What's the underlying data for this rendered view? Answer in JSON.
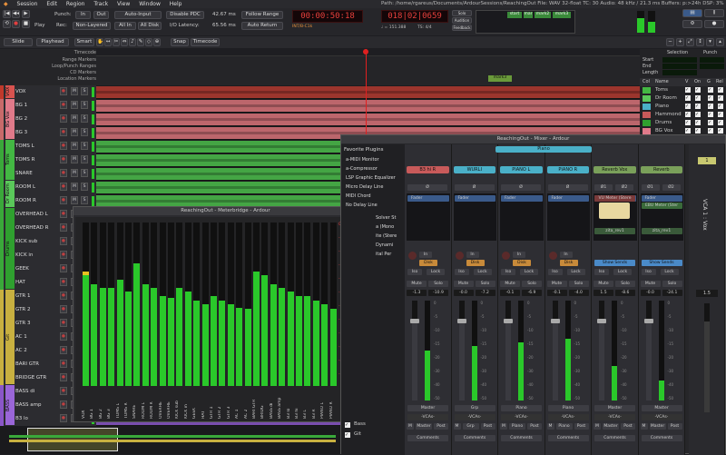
{
  "menu": [
    "Session",
    "Edit",
    "Region",
    "Track",
    "View",
    "Window",
    "Help"
  ],
  "path_info": "Path: /home/rgareus/Documents/ArdourSessions/ReachingOut   File: WAV 32-float   TC: 30   Audio: 48 kHz / 21.3 ms   Buffers: p:>24h   DSP: 3%",
  "transport": {
    "punch_label": "Punch:",
    "in_label": "In",
    "out_label": "Out",
    "play_label": "Play",
    "rec_label": "Rec:",
    "non_layered": "Non-Layered",
    "auto_input": "Auto-Input",
    "all_in": "All In",
    "all_disk": "All Disk",
    "disable_pdc": "Disable PDC",
    "io_latency_label": "I/O Latency:",
    "latency_1": "42.67 ms",
    "latency_2": "65.56 ms",
    "follow_range": "Follow Range",
    "auto_return": "Auto Return",
    "int_label": "INT/B-C1k",
    "primary_clock": "00:00:50:18",
    "secondary_clock": "018|02|0659",
    "tempo": "♩ = 151.388",
    "ts": "TS: 4/4",
    "solo": "Solo",
    "audition": "Audition",
    "feedback": "Feedback",
    "markers": [
      "start",
      "mar",
      "mark2",
      "mark3"
    ]
  },
  "toolbar": {
    "mode": "Slide",
    "playhead": "Playhead",
    "smart": "Smart",
    "snap": "Snap",
    "timecode": "Timecode"
  },
  "rulers": [
    "Timecode",
    "Range Markers",
    "Loop/Punch Ranges",
    "CD Markers",
    "Location Markers"
  ],
  "marker3": "mark3",
  "tracks": [
    {
      "name": "VOX",
      "color": "#c0392b",
      "region": "#b33a30",
      "group": "VOX",
      "gcolor": "#d9534f"
    },
    {
      "name": "BG 1",
      "color": "#c86a6a",
      "region": "#d9737a",
      "group": "BG Vox",
      "gcolor": "#e07a8a"
    },
    {
      "name": "BG 2",
      "color": "#c86a6a",
      "region": "#d9737a",
      "group": "",
      "gcolor": ""
    },
    {
      "name": "BG 3",
      "color": "#c86a6a",
      "region": "#d9737a",
      "group": "",
      "gcolor": ""
    },
    {
      "name": "TOMS L",
      "color": "#3aa83a",
      "region": "#4bbd4b",
      "group": "Toms",
      "gcolor": "#43b843"
    },
    {
      "name": "TOMS R",
      "color": "#3aa83a",
      "region": "#4bbd4b",
      "group": "",
      "gcolor": ""
    },
    {
      "name": "SNARE",
      "color": "#3aa83a",
      "region": "#4bbd4b",
      "group": "",
      "gcolor": ""
    },
    {
      "name": "ROOM L",
      "color": "#3aa83a",
      "region": "#4bbd4b",
      "group": "Dr Room",
      "gcolor": "#5ac85a"
    },
    {
      "name": "ROOM R",
      "color": "#3aa83a",
      "region": "#4bbd4b",
      "group": "",
      "gcolor": ""
    },
    {
      "name": "OVERHEAD L",
      "color": "#3aa83a",
      "region": "#4bbd4b",
      "group": "Drums",
      "gcolor": "#2fa02f"
    },
    {
      "name": "OVERHEAD R",
      "color": "#3aa83a",
      "region": "#4bbd4b",
      "group": "",
      "gcolor": ""
    },
    {
      "name": "KICK sub",
      "color": "#3aa83a",
      "region": "#4bbd4b",
      "group": "",
      "gcolor": ""
    },
    {
      "name": "KICK in",
      "color": "#3aa83a",
      "region": "#4bbd4b",
      "group": "",
      "gcolor": ""
    },
    {
      "name": "GEEK",
      "color": "#3aa83a",
      "region": "#4bbd4b",
      "group": "",
      "gcolor": ""
    },
    {
      "name": "HAT",
      "color": "#3aa83a",
      "region": "#4bbd4b",
      "group": "",
      "gcolor": ""
    },
    {
      "name": "GTR 1",
      "color": "#c8b040",
      "region": "#c8b040",
      "group": "Git",
      "gcolor": "#c8b040"
    },
    {
      "name": "GTR 2",
      "color": "#c8b040",
      "region": "#c8b040",
      "group": "",
      "gcolor": ""
    },
    {
      "name": "GTR 3",
      "color": "#c8b040",
      "region": "#c8b040",
      "group": "",
      "gcolor": ""
    },
    {
      "name": "AC 1",
      "color": "#c8b040",
      "region": "#c8b040",
      "group": "",
      "gcolor": ""
    },
    {
      "name": "AC 2",
      "color": "#c8b040",
      "region": "#c8b040",
      "group": "",
      "gcolor": ""
    },
    {
      "name": "BARI GTR",
      "color": "#c8b040",
      "region": "#c8b040",
      "group": "",
      "gcolor": ""
    },
    {
      "name": "BRIDGE GTR",
      "color": "#c8b040",
      "region": "#c8b040",
      "group": "",
      "gcolor": ""
    },
    {
      "name": "BASS di",
      "color": "#8a56c8",
      "region": "#8a56c8",
      "group": "BASS",
      "gcolor": "#9a66d8"
    },
    {
      "name": "BASS amp",
      "color": "#8a56c8",
      "region": "#8a56c8",
      "group": "",
      "gcolor": ""
    },
    {
      "name": "B3 lo",
      "color": "#8a56c8",
      "region": "#8a56c8",
      "group": "",
      "gcolor": ""
    }
  ],
  "track_buttons": {
    "rec": "●",
    "mute": "M",
    "solo": "S"
  },
  "right_panel": {
    "selection": "Selection",
    "punch": "Punch",
    "start": "Start",
    "end": "End",
    "length": "Length",
    "col_header": [
      "Col",
      "Name",
      "V",
      "On",
      "G",
      "Rel"
    ],
    "groups": [
      {
        "name": "Toms",
        "color": "#43b843"
      },
      {
        "name": "Dr Room",
        "color": "#5ac85a"
      },
      {
        "name": "Piano",
        "color": "#4ab0c8"
      },
      {
        "name": "Hammond",
        "color": "#c85a5a"
      },
      {
        "name": "Drums",
        "color": "#2fa02f"
      },
      {
        "name": "BG Vox",
        "color": "#e07a8a"
      }
    ]
  },
  "meterbridge": {
    "title": "ReachingOut - Meterbridge - Ardour",
    "labels": [
      "VOX",
      "BG 1",
      "BG 2",
      "BG 3",
      "TOMS L",
      "TOMS R",
      "SNARE",
      "ROOM L",
      "ROOM R",
      "OVERHE",
      "OVERHE",
      "KICK sub",
      "KICK in",
      "GEEK",
      "HAT",
      "GTR 1",
      "GTR 2",
      "GTR 3",
      "AC 1",
      "AC 2",
      "BARI GTR",
      "BRIDG",
      "BASS di",
      "BASS amp",
      "B3 lo",
      "B3 hi",
      "B3 L",
      "B3 R",
      "PIANO L",
      "PIANO R"
    ],
    "levels": [
      0.7,
      0.62,
      0.6,
      0.6,
      0.65,
      0.58,
      0.75,
      0.62,
      0.6,
      0.55,
      0.54,
      0.6,
      0.58,
      0.52,
      0.5,
      0.55,
      0.52,
      0.5,
      0.48,
      0.47,
      0.7,
      0.68,
      0.62,
      0.6,
      0.58,
      0.55,
      0.55,
      0.52,
      0.5,
      0.47
    ],
    "master_label": "Master",
    "scale": [
      "0",
      "-3",
      "-5",
      "-10",
      "-15",
      "-20",
      "-25",
      "-30",
      "-35",
      "-40",
      "-45",
      "-50"
    ]
  },
  "mixer": {
    "title": "ReachingOut - Mixer - Ardour",
    "favorite_plugins": "Favorite Plugins",
    "plugins": [
      "a-MIDI Monitor",
      "a-Compressor",
      "LSP Graphic Equalizer",
      "Micro Delay Line",
      "MIDI Chord",
      "No Delay Line"
    ],
    "tail_plugins": [
      "Solver St",
      "a (Mono",
      "ite (Stere",
      "Dynami",
      "ital Per"
    ],
    "strips": [
      {
        "name": "B3 hi R",
        "color": "#c85a5a",
        "gain": "-1.3",
        "peak": "-10.9",
        "out": "Master",
        "level": 0.5
      },
      {
        "name": "WURLI",
        "color": "#4ab0c8",
        "gain": "-0.0",
        "peak": "-7.2",
        "out": "Grp",
        "level": 0.55
      },
      {
        "name": "PIANO L",
        "color": "#4ab0c8",
        "gain": "-0.1",
        "peak": "-6.9",
        "out": "Piano",
        "level": 0.58
      },
      {
        "name": "PIANO R",
        "color": "#4ab0c8",
        "gain": "-0.1",
        "peak": "-4.0",
        "out": "Piano",
        "level": 0.62
      },
      {
        "name": "Reverb Vox",
        "color": "#7aa05a",
        "gain": "1.5",
        "peak": "-8.6",
        "out": "Master",
        "level": 0.35
      },
      {
        "name": "Reverb",
        "color": "#7aa05a",
        "gain": "-0.0",
        "peak": "-24.1",
        "out": "Master",
        "level": 0.2
      }
    ],
    "piano_group": "Piano",
    "fader": "Fader",
    "vu_meter": "VU Meter (Stere",
    "ebu_meter": "EBU Meter (Ster",
    "zita_rev": "zita_rev1",
    "show_sends": "Show Sends",
    "in": "In",
    "disk": "Disk",
    "iso": "Iso",
    "lock": "Lock",
    "mute": "Mute",
    "solo": "Solo",
    "vcas": "-VCAs-",
    "comments": "Comments",
    "mute_m": "M",
    "post": "Post",
    "phase": "Ø",
    "phase1": "Ø1",
    "phase2": "Ø2",
    "vca_label": "VCA 1 : Vox",
    "vca_num": "1",
    "vca_gain": "1.5",
    "group_list": [
      "Bass",
      "Git"
    ],
    "fader_scale": [
      "0",
      "-5",
      "-10",
      "-15",
      "-20",
      "-30",
      "-40",
      "-50"
    ]
  }
}
